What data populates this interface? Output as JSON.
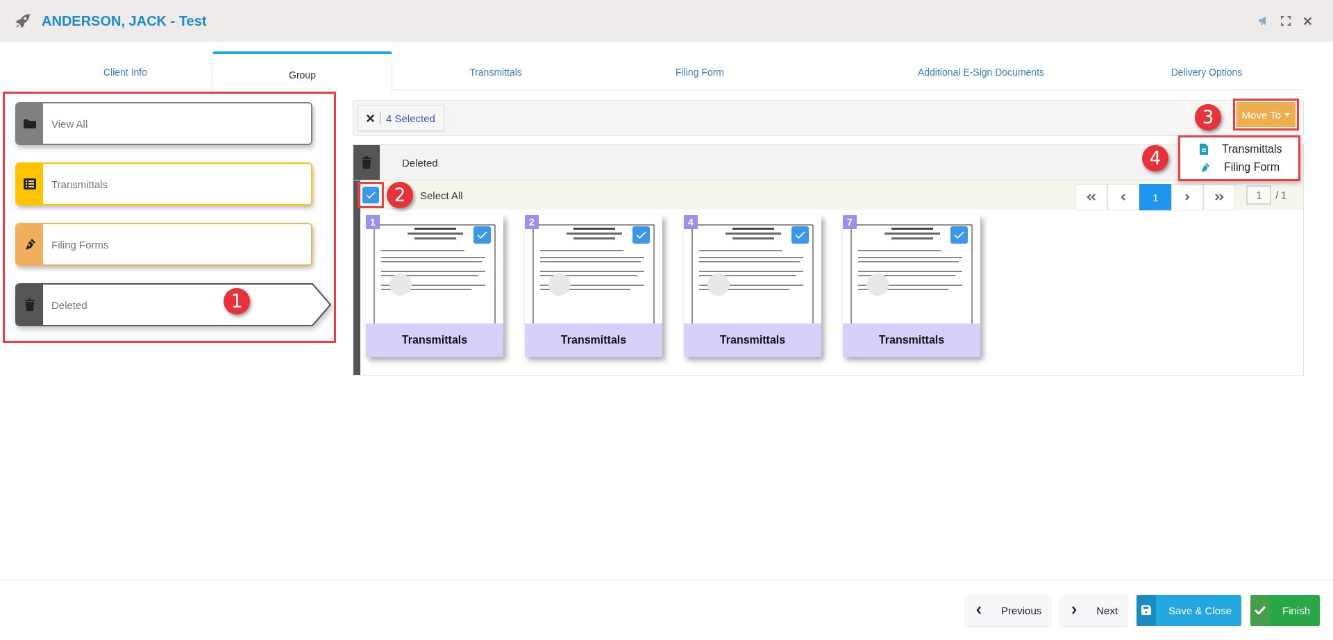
{
  "header": {
    "title": "ANDERSON, JACK - Test"
  },
  "tabs": [
    {
      "label": "Client Info",
      "selected": false
    },
    {
      "label": "Group",
      "selected": true
    },
    {
      "label": "Transmittals",
      "selected": false
    },
    {
      "label": "Filing Form",
      "selected": false
    },
    {
      "label": "Additional E-Sign Documents",
      "selected": false
    },
    {
      "label": "Delivery Options",
      "selected": false
    }
  ],
  "sidebar": {
    "highlighted": true,
    "annotation": "1",
    "items": [
      {
        "label": "View All",
        "kind": "folder",
        "color": "#808080",
        "selected": false
      },
      {
        "label": "Transmittals",
        "kind": "list",
        "color": "#ffc400",
        "selected": false
      },
      {
        "label": "Filing Forms",
        "kind": "pen",
        "color": "#f0b060",
        "selected": false
      },
      {
        "label": "Deleted",
        "kind": "trash",
        "color": "#555555",
        "selected": true
      }
    ]
  },
  "toolbar": {
    "selected_count": "4 Selected",
    "move_button": {
      "label": "Move To",
      "highlighted": true,
      "annotation": "3"
    },
    "move_menu": {
      "highlighted": true,
      "annotation": "4",
      "items": [
        {
          "label": "Transmittals",
          "kind": "document"
        },
        {
          "label": "Filing Form",
          "kind": "pen"
        }
      ]
    }
  },
  "group": {
    "title": "Deleted",
    "select_all": {
      "label": "Select All",
      "checked": true,
      "highlighted": true,
      "annotation": "2"
    },
    "pagination": {
      "pages": [
        {
          "label": "1",
          "selected": true
        }
      ],
      "page_input": "1",
      "page_total": "/ 1"
    },
    "documents": [
      {
        "number": "1",
        "checked": true,
        "caption": "Transmittals"
      },
      {
        "number": "2",
        "checked": true,
        "caption": "Transmittals"
      },
      {
        "number": "4",
        "checked": true,
        "caption": "Transmittals"
      },
      {
        "number": "7",
        "checked": true,
        "caption": "Transmittals"
      }
    ]
  },
  "footer": {
    "buttons": [
      {
        "label": "Previous",
        "kind": "previous"
      },
      {
        "label": "Next",
        "kind": "next"
      },
      {
        "label": "Save & Close",
        "kind": "save"
      },
      {
        "label": "Finish",
        "kind": "finish"
      }
    ]
  }
}
